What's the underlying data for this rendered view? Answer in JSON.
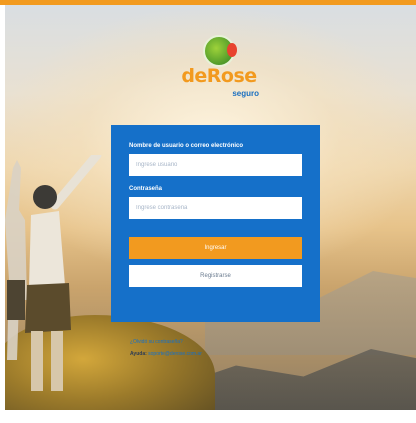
{
  "brand": {
    "name": "deRose",
    "suffix": "seguro",
    "accent_color": "#f29a1f",
    "primary_color": "#1570c9"
  },
  "login": {
    "username_label": "Nombre de usuario o correo electrónico",
    "username_placeholder": "Ingrese usuario",
    "password_label": "Contraseña",
    "password_placeholder": "Ingrese contraseña",
    "submit_label": "Ingresar",
    "register_label": "Registrarse"
  },
  "footer_links": {
    "forgot_password": "¿Olvidó su contraseña?",
    "help_prefix": "Ayuda:",
    "help_email": "soporte@derose.com.ar"
  }
}
